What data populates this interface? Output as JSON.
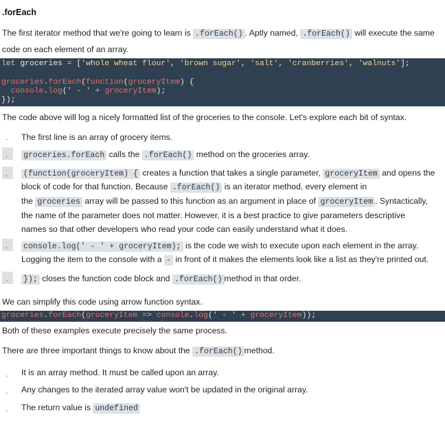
{
  "heading": ".forEach",
  "intro": {
    "t1": "The first iterator method that we're going to learn is ",
    "c1": ".forEach()",
    "t2": ". Aptly named, ",
    "c2": ".forEach()",
    "t3": " will execute the same",
    "t4": "code on each element of an array."
  },
  "code_block_1": {
    "l1": {
      "kw": "let",
      "var": " groceries ",
      "op": "=",
      "p1": " [",
      "s1": "'whole wheat flour'",
      "s2": "'brown sugar'",
      "s3": "'salt'",
      "s4": "'cranberries'",
      "s5": "'walnuts'",
      "p2": "];",
      "sep": ", "
    },
    "l3": {
      "v": "groceries",
      "dot": ".",
      "fn": "forEach",
      "p1": "(",
      "kw": "function",
      "p2": "(",
      "arg": "groceryItem",
      "p3": ") {"
    },
    "l4": {
      "indent": "  ",
      "obj": "console",
      "dot": ".",
      "fn": "log",
      "p1": "(",
      "s1": "' - '",
      "op": " + ",
      "v": "groceryItem",
      "p2": ");"
    },
    "l5": "});"
  },
  "after_code": "The code above will log a nicely formatted list of the groceries to the console. Let's explore each bit of syntax.",
  "bullets": [
    {
      "dot": ".",
      "text": "The first line is an array of grocery items."
    },
    {
      "dot": ".",
      "code": "groceries.forEach",
      "t1": " calls the ",
      "c2": ".forEach()",
      "t2": " method on the groceries array."
    },
    {
      "dot": ".",
      "code": "(function(groceryItem) {",
      "t1": " creates a function that takes a single parameter, ",
      "c2": "groceryItem",
      "t2": " and opens the",
      "l2a": "block of code for that function. Because ",
      "l2c": ".forEach()",
      "l2b": " is an iterator method, every element in",
      "l3a": "the ",
      "l3c": "groceries",
      "l3b": " array will be passed to this function as an argument in place of ",
      "l3c2": "groceryItem",
      "l3d": ". Syntactically,",
      "l4": "the name of the parameter does not matter. However, it is a best practice to give parameters descriptive",
      "l5": "names so that other developers who read your code can easily understand what it does."
    },
    {
      "dot": ".",
      "code": "console.log(' - ' + groceryItem);",
      "t1": " is the code we wish to execute upon each element in the array.",
      "l2a": "Logging the item to the console with a ",
      "l2c": "-",
      "l2b": " in front of it makes the elements look like a list as they're printed out."
    },
    {
      "dot": ".",
      "code": "});",
      "t1": " closes the function code block and ",
      "c2": ".forEach()",
      "t2": "method in that order."
    }
  ],
  "arrow_intro": "We can simplify this code using arrow function syntax.",
  "code_block_2": {
    "v": "groceries",
    "dot": ".",
    "fn": "forEach",
    "p1": "(",
    "arg": "groceryItem",
    "arrow": " => ",
    "obj": "console",
    "dot2": ".",
    "fn2": "log",
    "p2": "(",
    "s1": "' - '",
    "op": " + ",
    "v2": "groceryItem",
    "p3": "));"
  },
  "both": "Both of these examples execute precisely the same process.",
  "three": {
    "t1": "There are three important things to know about the ",
    "c1": ".forEach()",
    "t2": "method."
  },
  "points": [
    {
      "dot": ".",
      "text": "It is an array method. It must be called upon an array."
    },
    {
      "dot": ".",
      "text": "Any changes to the iterated array value won't be updated in the original array."
    },
    {
      "dot": ".",
      "text": "The return value is ",
      "code": "undefined"
    }
  ]
}
